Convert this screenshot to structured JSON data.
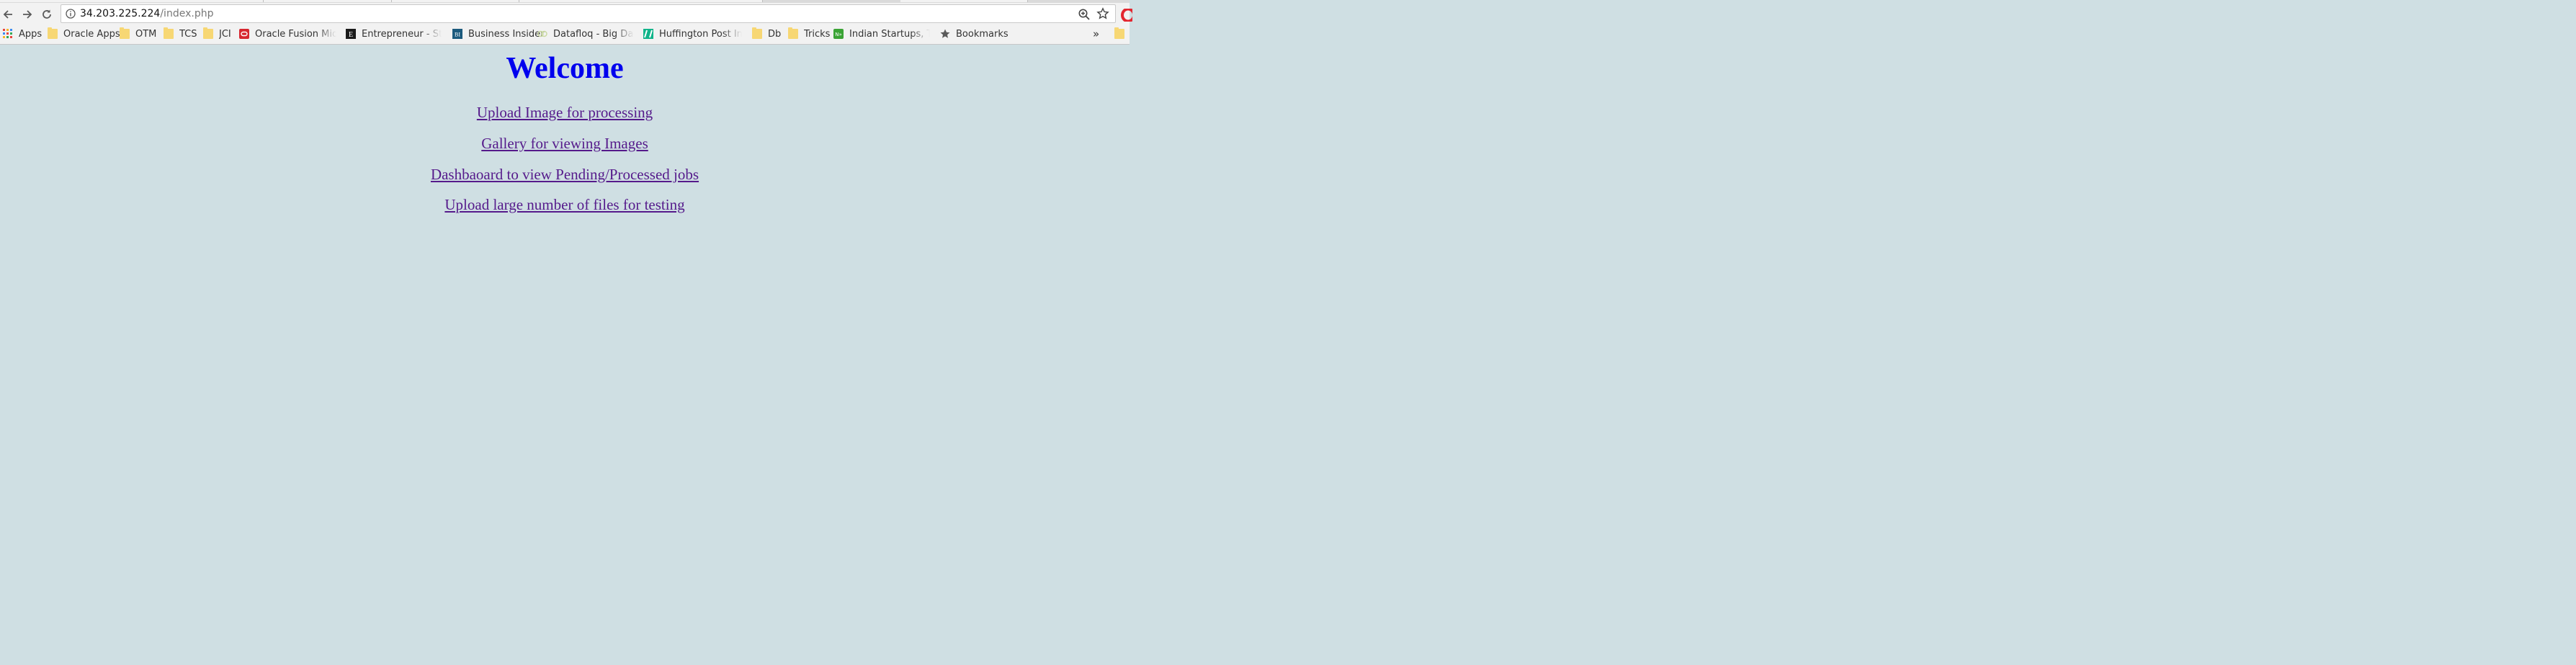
{
  "browser": {
    "url_host": "34.203.225.224",
    "url_path": "/index.php"
  },
  "bookmarks": [
    {
      "label": "Apps",
      "icon": "apps-grid-icon"
    },
    {
      "label": "Oracle Apps",
      "icon": "folder-icon"
    },
    {
      "label": "OTM",
      "icon": "folder-icon"
    },
    {
      "label": "TCS",
      "icon": "folder-icon"
    },
    {
      "label": "JCI",
      "icon": "folder-icon"
    },
    {
      "label": "Oracle Fusion Middle",
      "icon": "oracle-icon"
    },
    {
      "label": "Entrepreneur - Start,",
      "icon": "entrepreneur-icon"
    },
    {
      "label": "Business Insider",
      "icon": "business-insider-icon"
    },
    {
      "label": "Datafloq - Big Data P",
      "icon": "datafloq-icon"
    },
    {
      "label": "Huffington Post India",
      "icon": "huffington-icon"
    },
    {
      "label": "Db",
      "icon": "folder-icon"
    },
    {
      "label": "Tricks",
      "icon": "folder-icon"
    },
    {
      "label": "Indian Startups, Tech",
      "icon": "startups-icon"
    },
    {
      "label": "Bookmarks",
      "icon": "star-icon"
    }
  ],
  "bookmarks_overflow": "»",
  "page": {
    "heading": "Welcome",
    "links": [
      "Upload Image for processing",
      "Gallery for viewing Images",
      "Dashbaoard to view Pending/Processed jobs",
      "Upload large number of files for testing"
    ]
  },
  "colors": {
    "page_background": "#cfdfe3",
    "heading": "#0000ee",
    "visited_link": "#551a8b"
  }
}
